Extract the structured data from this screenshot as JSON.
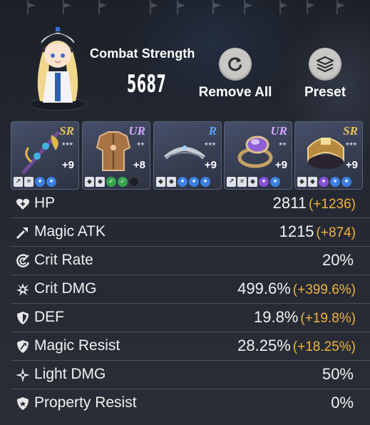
{
  "header": {
    "combat_strength_label": "Combat Strength",
    "combat_strength_value": "5687",
    "remove_all_label": "Remove All",
    "preset_label": "Preset"
  },
  "equipment": [
    {
      "rarity": "SR",
      "rarity_color": "#e7c15d",
      "level": "+9",
      "badges": [
        "white-dagger",
        "white-burst",
        "blue",
        "blue"
      ]
    },
    {
      "rarity": "UR",
      "rarity_color": "#d7a6ff",
      "level": "+8",
      "badges": [
        "white-shield",
        "white-shield",
        "green",
        "green",
        "empty"
      ]
    },
    {
      "rarity": "R",
      "rarity_color": "#5aa6ff",
      "level": "+9",
      "badges": [
        "white-shield",
        "white-shield",
        "blue",
        "blue",
        "blue"
      ]
    },
    {
      "rarity": "UR",
      "rarity_color": "#d7a6ff",
      "level": "+9",
      "badges": [
        "white-dagger",
        "white-burst",
        "white-shield",
        "purple",
        "blue"
      ]
    },
    {
      "rarity": "SR",
      "rarity_color": "#e7c15d",
      "level": "+9",
      "badges": [
        "white-shield",
        "white-shield",
        "purple",
        "blue",
        "blue"
      ]
    }
  ],
  "stats": [
    {
      "icon": "heart-plus-icon",
      "name": "HP",
      "value": "2811",
      "bonus": "(+1236)"
    },
    {
      "icon": "wand-icon",
      "name": "Magic ATK",
      "value": "1215",
      "bonus": "(+874)"
    },
    {
      "icon": "crit-rate-icon",
      "name": "Crit Rate",
      "value": "20%",
      "bonus": ""
    },
    {
      "icon": "burst-icon",
      "name": "Crit DMG",
      "value": "499.6%",
      "bonus": "(+399.6%)"
    },
    {
      "icon": "shield-icon",
      "name": "DEF",
      "value": "19.8%",
      "bonus": "(+19.8%)"
    },
    {
      "icon": "magic-shield-icon",
      "name": "Magic Resist",
      "value": "28.25%",
      "bonus": "(+18.25%)"
    },
    {
      "icon": "sparkle-icon",
      "name": "Light DMG",
      "value": "50%",
      "bonus": ""
    },
    {
      "icon": "property-shield-icon",
      "name": "Property Resist",
      "value": "0%",
      "bonus": ""
    }
  ],
  "colors": {
    "bonus": "#f0b43c",
    "accent_button": "#c9c7c3"
  }
}
